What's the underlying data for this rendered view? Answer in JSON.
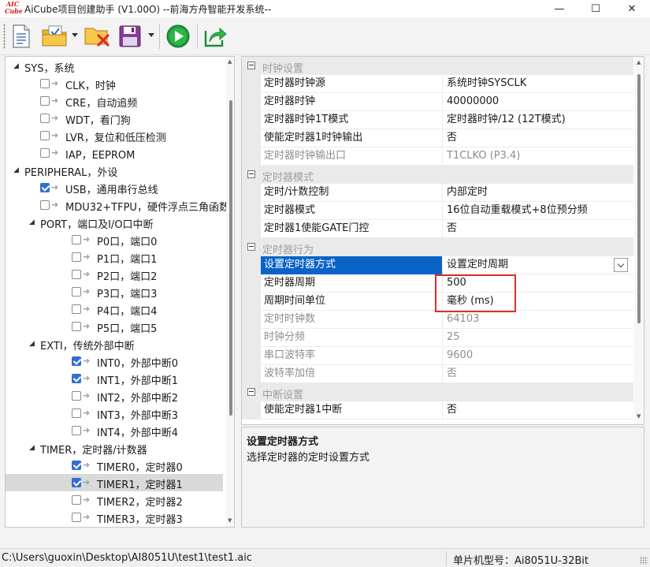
{
  "window": {
    "title": "AiCube项目创建助手 (V1.00O) --前海方舟智能开发系统--",
    "logo_text": "AIC Cube",
    "minimize_glyph": "—",
    "maximize_glyph": "☐",
    "close_glyph": "✕"
  },
  "toolbar": {
    "icons": [
      "new-document-icon",
      "open-folder-icon",
      "close-project-icon",
      "save-icon",
      "run-icon",
      "export-icon"
    ]
  },
  "tree": {
    "nodes": [
      {
        "label": "SYS，系统",
        "level": 0,
        "expanded": true,
        "checkbox": false
      },
      {
        "label": "CLK，时钟",
        "level": 1,
        "checkbox": true,
        "checked": false
      },
      {
        "label": "CRE，自动追频",
        "level": 1,
        "checkbox": true,
        "checked": false
      },
      {
        "label": "WDT，看门狗",
        "level": 1,
        "checkbox": true,
        "checked": false
      },
      {
        "label": "LVR，复位和低压检测",
        "level": 1,
        "checkbox": true,
        "checked": false
      },
      {
        "label": "IAP，EEPROM",
        "level": 1,
        "checkbox": true,
        "checked": false
      },
      {
        "label": "PERIPHERAL，外设",
        "level": 0,
        "expanded": true,
        "checkbox": false
      },
      {
        "label": "USB，通用串行总线",
        "level": 1,
        "checkbox": true,
        "checked": true
      },
      {
        "label": "MDU32+TFPU，硬件浮点三角函数",
        "level": 1,
        "checkbox": true,
        "checked": false
      },
      {
        "label": "PORT，端口及I/O口中断",
        "level": 1,
        "expanded": true,
        "checkbox": false
      },
      {
        "label": "P0口，端口0",
        "level": 2,
        "checkbox": true,
        "checked": false
      },
      {
        "label": "P1口，端口1",
        "level": 2,
        "checkbox": true,
        "checked": false
      },
      {
        "label": "P2口，端口2",
        "level": 2,
        "checkbox": true,
        "checked": false
      },
      {
        "label": "P3口，端口3",
        "level": 2,
        "checkbox": true,
        "checked": false
      },
      {
        "label": "P4口，端口4",
        "level": 2,
        "checkbox": true,
        "checked": false
      },
      {
        "label": "P5口，端口5",
        "level": 2,
        "checkbox": true,
        "checked": false
      },
      {
        "label": "EXTI，传统外部中断",
        "level": 1,
        "expanded": true,
        "checkbox": false
      },
      {
        "label": "INT0，外部中断0",
        "level": 2,
        "checkbox": true,
        "checked": true
      },
      {
        "label": "INT1，外部中断1",
        "level": 2,
        "checkbox": true,
        "checked": true
      },
      {
        "label": "INT2，外部中断2",
        "level": 2,
        "checkbox": true,
        "checked": false
      },
      {
        "label": "INT3，外部中断3",
        "level": 2,
        "checkbox": true,
        "checked": false
      },
      {
        "label": "INT4，外部中断4",
        "level": 2,
        "checkbox": true,
        "checked": false
      },
      {
        "label": "TIMER，定时器/计数器",
        "level": 1,
        "expanded": true,
        "checkbox": false
      },
      {
        "label": "TIMER0，定时器0",
        "level": 2,
        "checkbox": true,
        "checked": true
      },
      {
        "label": "TIMER1，定时器1",
        "level": 2,
        "checkbox": true,
        "checked": true,
        "selected": true
      },
      {
        "label": "TIMER2，定时器2",
        "level": 2,
        "checkbox": true,
        "checked": false
      },
      {
        "label": "TIMER3，定时器3",
        "level": 2,
        "checkbox": true,
        "checked": false
      }
    ]
  },
  "properties": {
    "rows": [
      {
        "type": "category",
        "label": "时钟设置"
      },
      {
        "type": "prop",
        "name": "定时器时钟源",
        "value": "系统时钟SYSCLK"
      },
      {
        "type": "prop",
        "name": "定时器时钟",
        "value": "40000000"
      },
      {
        "type": "prop",
        "name": "定时器时钟1T模式",
        "value": "定时器时钟/12 (12T模式)"
      },
      {
        "type": "prop",
        "name": "使能定时器1时钟输出",
        "value": "否"
      },
      {
        "type": "prop",
        "name": "定时器时钟输出口",
        "value": "T1CLKO (P3.4)",
        "disabled": true
      },
      {
        "type": "category",
        "label": "定时器模式"
      },
      {
        "type": "prop",
        "name": "定时/计数控制",
        "value": "内部定时"
      },
      {
        "type": "prop",
        "name": "定时器模式",
        "value": "16位自动重载模式+8位预分频"
      },
      {
        "type": "prop",
        "name": "定时器1使能GATE门控",
        "value": "否"
      },
      {
        "type": "category",
        "label": "定时器行为"
      },
      {
        "type": "prop",
        "name": "设置定时器方式",
        "value": "设置定时周期",
        "selected": true,
        "dropdown": true
      },
      {
        "type": "prop",
        "name": "定时器周期",
        "value": "500"
      },
      {
        "type": "prop",
        "name": "周期时间单位",
        "value": "毫秒 (ms)"
      },
      {
        "type": "prop",
        "name": "定时时钟数",
        "value": "64103",
        "disabled": true
      },
      {
        "type": "prop",
        "name": "时钟分频",
        "value": "25",
        "disabled": true
      },
      {
        "type": "prop",
        "name": "串口波特率",
        "value": "9600",
        "disabled": true
      },
      {
        "type": "prop",
        "name": "波特率加倍",
        "value": "否",
        "disabled": true
      },
      {
        "type": "category",
        "label": "中断设置"
      },
      {
        "type": "prop",
        "name": "使能定时器1中断",
        "value": "否"
      }
    ]
  },
  "description": {
    "title": "设置定时器方式",
    "text": "选择定时器的定时设置方式"
  },
  "status": {
    "path": "C:\\Users\\guoxin\\Desktop\\AI8051U\\test1\\test1.aic",
    "chip": "单片机型号：Ai8051U-32Bit"
  },
  "colors": {
    "selection": "#0a64c8",
    "checkbox_on": "#2f6fd6",
    "highlight_box": "#d9302c",
    "run_green": "#1e9a3a"
  }
}
